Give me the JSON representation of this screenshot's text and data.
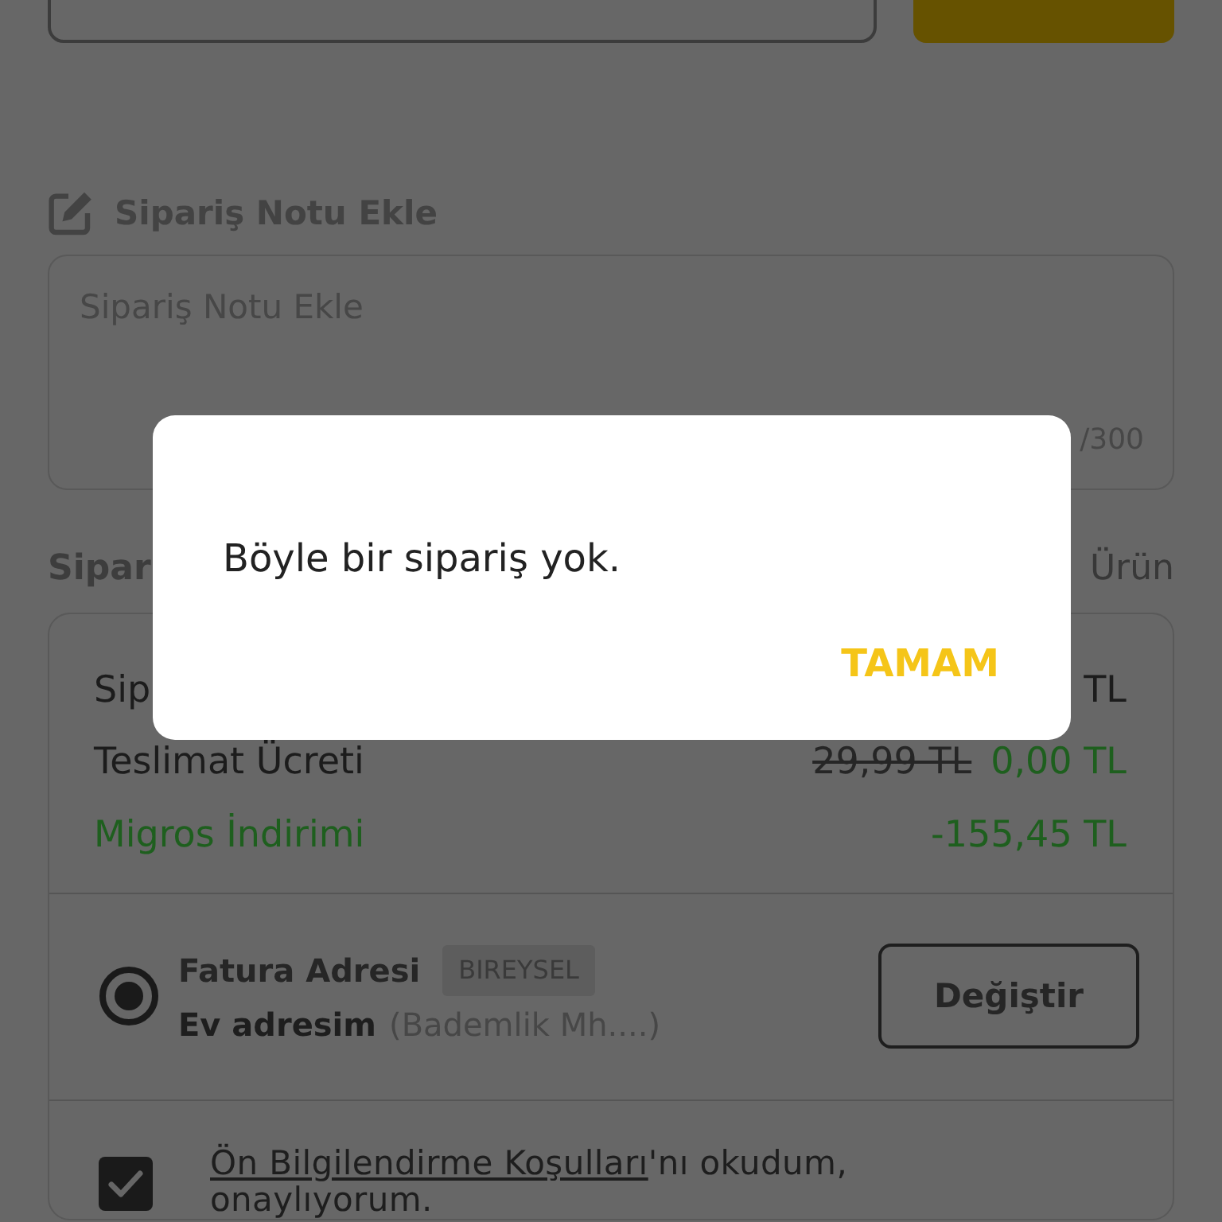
{
  "note_section": {
    "title": "Sipariş Notu Ekle",
    "field": {
      "placeholder": "Sipariş Notu Ekle",
      "counter": "/300"
    }
  },
  "summary": {
    "title": "Sipar",
    "count": "Ürün",
    "rows": [
      {
        "kind": "plain",
        "label": "Sip",
        "value": "TL"
      },
      {
        "kind": "discounted",
        "label": "Teslimat Ücreti",
        "old_value": "29,99 TL",
        "value": "0,00 TL"
      },
      {
        "kind": "discount",
        "label": "Migros İndirimi",
        "value": "-155,45 TL"
      }
    ]
  },
  "address": {
    "selected": true,
    "title": "Fatura Adresi",
    "badge": "BIREYSEL",
    "name": "Ev adresim",
    "detail": "(Bademlik Mh....)",
    "button": "Değiştir"
  },
  "agreement": {
    "checked": true,
    "link": "Ön Bilgilendirme Koşulları",
    "text": "'nı okudum, onaylıyorum."
  },
  "dialog": {
    "message": "Böyle bir sipariş yok.",
    "button": "TAMAM"
  }
}
